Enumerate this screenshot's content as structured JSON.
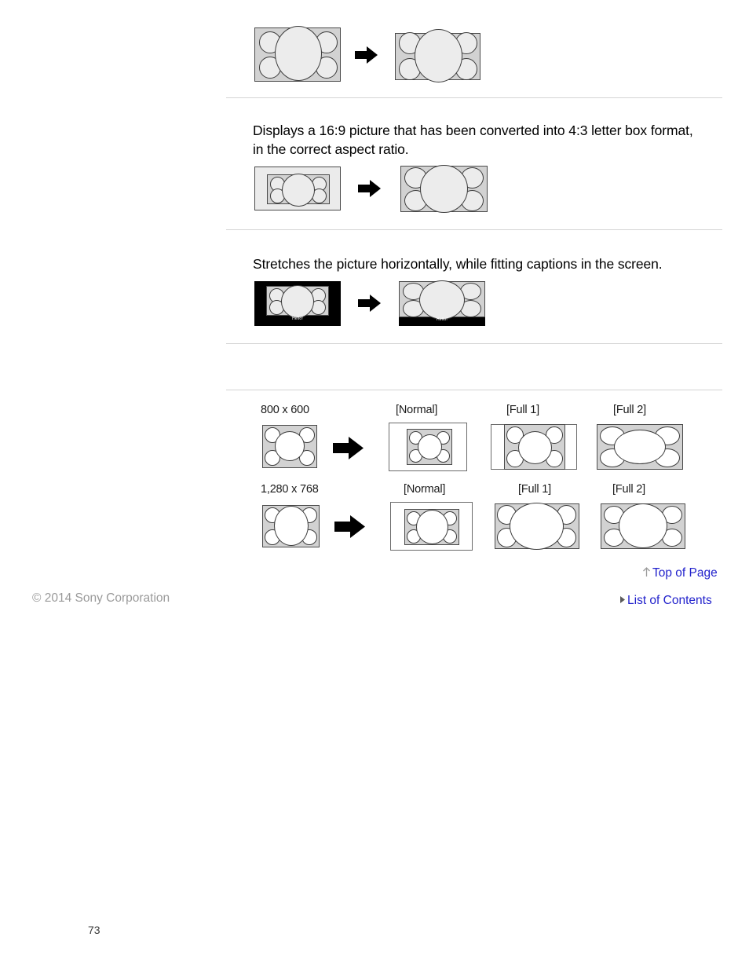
{
  "document": {
    "page_number": "73",
    "copyright": "© 2014 Sony Corporation"
  },
  "sections": [
    {
      "id": "wide-zoom-continued",
      "description": "",
      "diagram": {
        "source_label": "",
        "result_label": "",
        "arrow": "right-arrow-icon"
      }
    },
    {
      "id": "normal-letterbox",
      "description": "Displays a 16:9 picture that has been converted into 4:3 letter box format, in the correct aspect ratio.",
      "diagram": {
        "arrow": "right-arrow-icon"
      }
    },
    {
      "id": "captions",
      "description": "Stretches the picture horizontally, while fitting captions in the screen.",
      "diagram": {
        "caption_text": "Hello!",
        "arrow": "right-arrow-icon"
      }
    },
    {
      "id": "blank-section",
      "description": ""
    }
  ],
  "pc_timing_diagram": {
    "mode_headers": [
      "[Normal]",
      "[Full 1]",
      "[Full 2]"
    ],
    "rows": [
      {
        "resolution": "800 x 600",
        "arrow": "right-arrow-icon",
        "modes": [
          "[Normal]",
          "[Full 1]",
          "[Full 2]"
        ]
      },
      {
        "resolution": "1,280 x 768",
        "arrow": "right-arrow-icon",
        "modes": [
          "[Normal]",
          "[Full 1]",
          "[Full 2]"
        ]
      }
    ]
  },
  "footer": {
    "top_of_page": {
      "label": "Top of Page",
      "icon": "up-arrow-icon"
    },
    "list_of_contents": {
      "label": "List of Contents",
      "icon": "triangle-right-icon"
    }
  },
  "colors": {
    "link": "#2222cc",
    "divider": "#d4d4d4",
    "copyright_text": "#9a9a9a",
    "pattern_background": "#d2d2d2",
    "pattern_circle": "#ececec",
    "pattern_border": "#4a4a4a"
  }
}
